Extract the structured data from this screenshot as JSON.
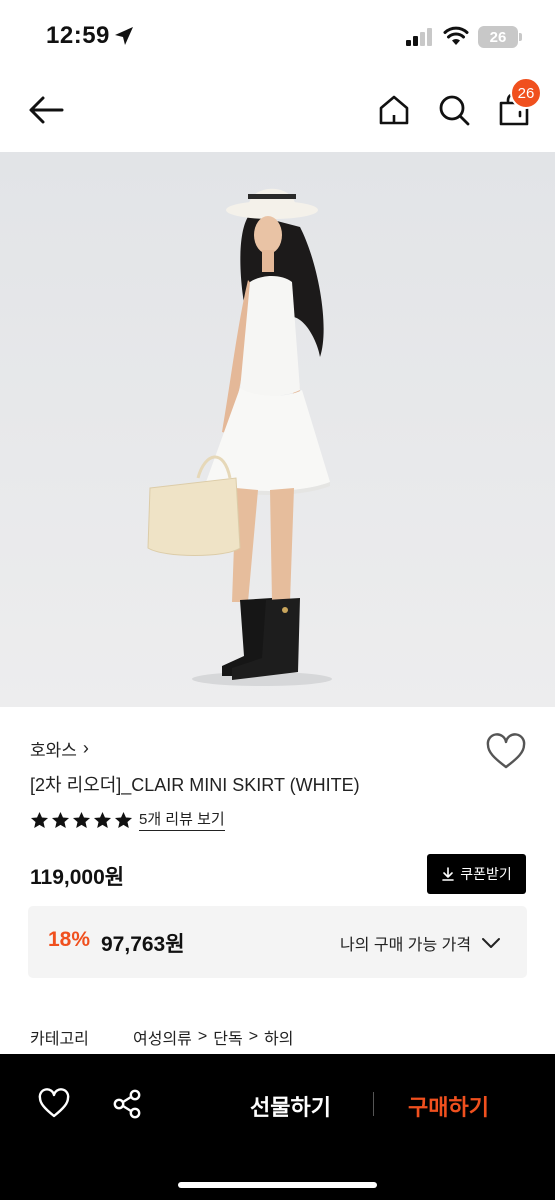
{
  "status_bar": {
    "time": "12:59",
    "battery": "26"
  },
  "nav": {
    "cart_count": "26"
  },
  "product": {
    "brand": "호와스",
    "brand_chevron": "›",
    "name": "[2차 리오더]_CLAIR MINI SKIRT (WHITE)",
    "rating_stars": 5,
    "review_link": "5개 리뷰 보기",
    "price": "119,000원",
    "coupon_label": "쿠폰받기",
    "discount_rate": "18%",
    "discount_price": "97,763원",
    "my_price_label": "나의 구매 가능 가격"
  },
  "category": {
    "label": "카테고리",
    "path": [
      "여성의류",
      "단독",
      "하의"
    ],
    "separator": ">"
  },
  "bottom_bar": {
    "gift_label": "선물하기",
    "buy_label": "구매하기"
  },
  "colors": {
    "accent": "#f0501e",
    "bottom_bar": "#000000"
  },
  "icons": [
    "location-arrow-icon",
    "signal-icon",
    "wifi-icon",
    "back-arrow-icon",
    "home-icon",
    "search-icon",
    "shopping-bag-icon",
    "heart-icon",
    "star-icon",
    "download-icon",
    "chevron-down-icon",
    "share-icon"
  ]
}
